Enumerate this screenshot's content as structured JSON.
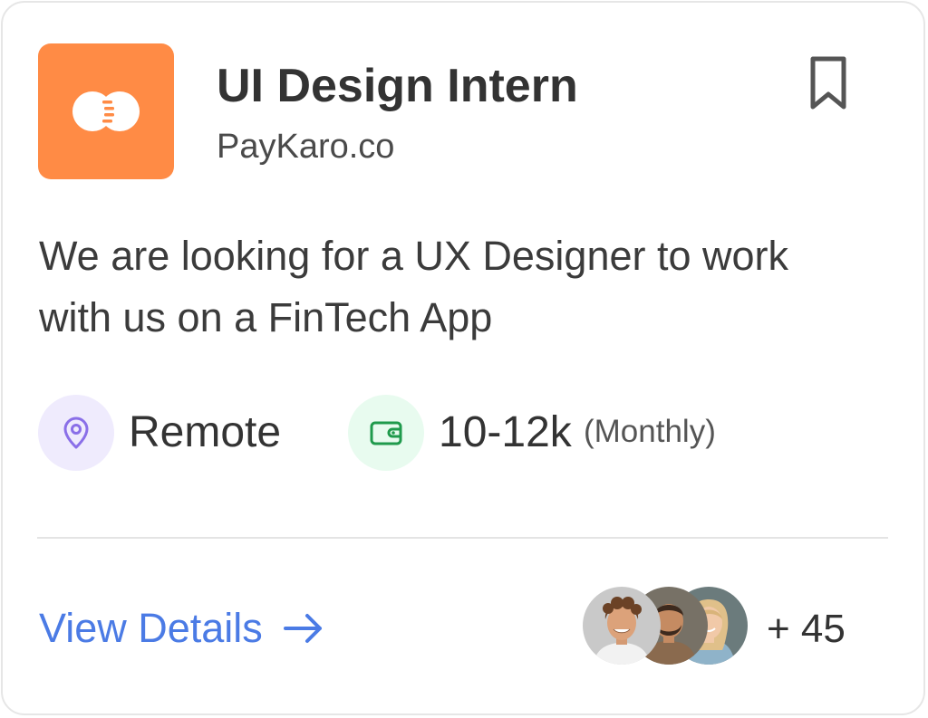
{
  "job": {
    "title": "UI Design Intern",
    "company": "PayKaro.co",
    "description": "We are looking for a UX Designer to work with us on a FinTech App",
    "location": "Remote",
    "salary": "10-12k",
    "salary_period": "(Monthly)"
  },
  "footer": {
    "view_details_label": "View Details",
    "applicants_more": "+ 45"
  },
  "icons": {
    "logo": "company-logo-icon",
    "bookmark": "bookmark-icon",
    "location": "location-pin-icon",
    "salary": "wallet-icon",
    "arrow": "arrow-right-icon"
  },
  "colors": {
    "logo_bg": "#ff8b45",
    "link": "#4b7be5",
    "location_icon": "#8a6fe8",
    "location_bg": "#efebfd",
    "salary_icon": "#1f9a4c",
    "salary_bg": "#e8fbef"
  }
}
